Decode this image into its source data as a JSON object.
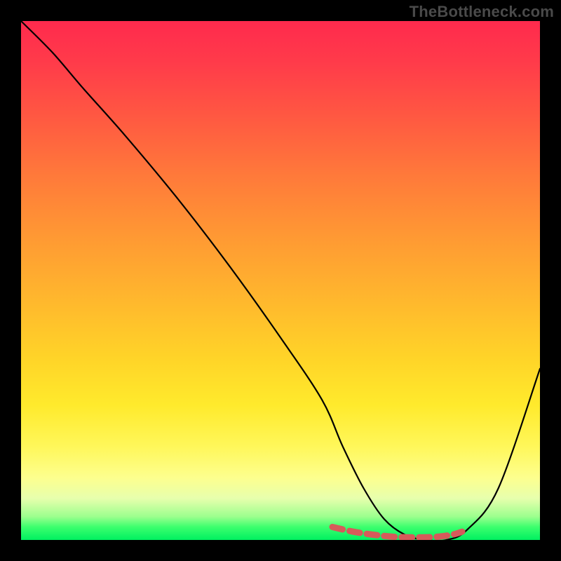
{
  "watermark": "TheBottleneck.com",
  "chart_data": {
    "type": "line",
    "title": "",
    "xlabel": "",
    "ylabel": "",
    "xlim": [
      0,
      100
    ],
    "ylim": [
      0,
      100
    ],
    "grid": false,
    "legend": false,
    "background": "vertical-gradient-green-to-red",
    "series": [
      {
        "name": "bottleneck-curve",
        "color": "#000000",
        "x": [
          0,
          6,
          12,
          20,
          30,
          40,
          50,
          58,
          62,
          66,
          70,
          74,
          78,
          82,
          86,
          92,
          100
        ],
        "y": [
          100,
          94,
          87,
          78,
          66,
          53,
          39,
          27,
          18,
          10,
          4,
          1,
          0,
          0,
          2,
          10,
          33
        ]
      }
    ],
    "annotations": [
      {
        "name": "optimal-range-dashes",
        "style": "dashed",
        "color": "#d65a5a",
        "x": [
          60,
          64,
          68,
          72,
          76,
          80,
          83,
          85
        ],
        "y": [
          2.5,
          1.6,
          1.0,
          0.6,
          0.5,
          0.6,
          1.0,
          1.6
        ]
      }
    ]
  }
}
